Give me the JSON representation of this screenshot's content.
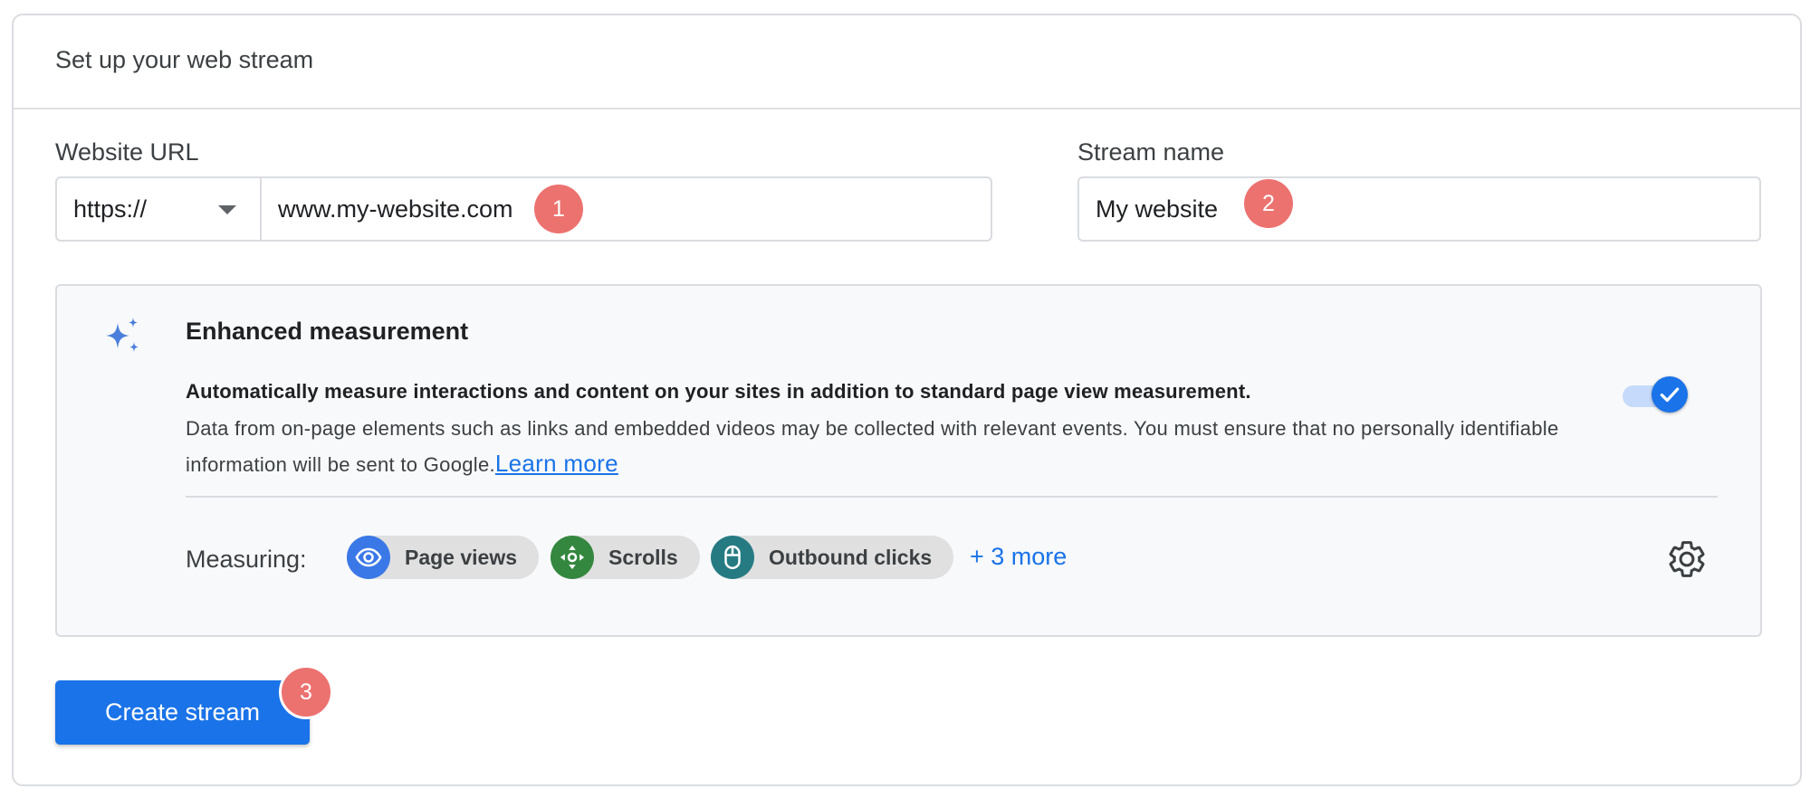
{
  "header": {
    "title": "Set up your web stream"
  },
  "website_url": {
    "label": "Website URL",
    "protocol": "https://",
    "value": "www.my-website.com",
    "step": "1"
  },
  "stream_name": {
    "label": "Stream name",
    "value": "My website",
    "step": "2"
  },
  "enhanced_measurement": {
    "title": "Enhanced measurement",
    "description_bold": "Automatically measure interactions and content on your sites in addition to standard page view measurement.",
    "description": "Data from on-page elements such as links and embedded videos may be collected with relevant events. You must ensure that no personally identifiable information will be sent to Google.",
    "learn_more": "Learn more",
    "toggle_on": true,
    "measuring_label": "Measuring:",
    "chips": [
      {
        "label": "Page views",
        "icon": "eye-icon",
        "color": "#3b78e7"
      },
      {
        "label": "Scrolls",
        "icon": "scroll-arrows-icon",
        "color": "#34873f"
      },
      {
        "label": "Outbound clicks",
        "icon": "mouse-icon",
        "color": "#267b83"
      }
    ],
    "more": "+ 3 more"
  },
  "create_button": {
    "label": "Create stream",
    "step": "3"
  },
  "colors": {
    "accent": "#1a73e8",
    "badge": "#ec7270"
  }
}
